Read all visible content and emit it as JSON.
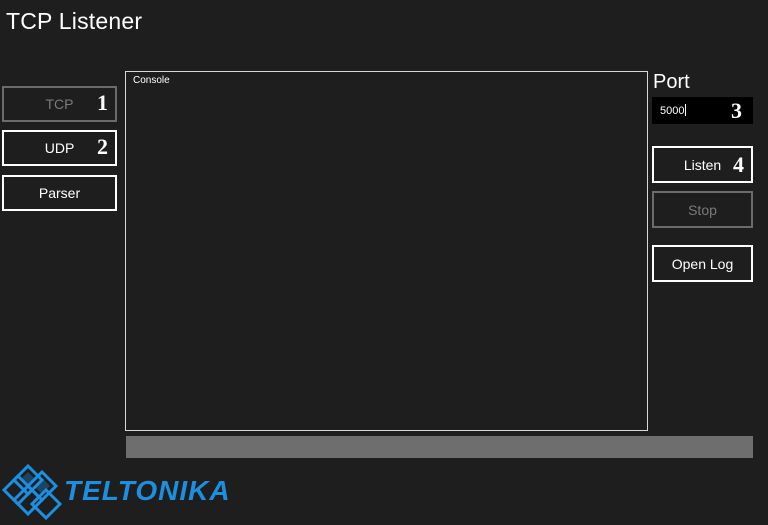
{
  "window": {
    "title": "TCP Listener"
  },
  "sidebar": {
    "items": [
      {
        "label": "TCP",
        "number": "1",
        "disabled": true
      },
      {
        "label": "UDP",
        "number": "2",
        "disabled": false
      },
      {
        "label": "Parser",
        "number": "",
        "disabled": false
      }
    ]
  },
  "console": {
    "label": "Console",
    "content": ""
  },
  "port": {
    "label": "Port",
    "value": "5000",
    "number": "3"
  },
  "actions": {
    "listen_label": "Listen",
    "listen_number": "4",
    "stop_label": "Stop",
    "open_log_label": "Open Log"
  },
  "progress": {
    "value": 0
  },
  "brand": {
    "name": "TELTONIKA",
    "color": "#1c8fe0"
  },
  "colors": {
    "background": "#1e1e1e",
    "disabled": "#7a7a7a",
    "progress_track": "#6e6e6e"
  }
}
